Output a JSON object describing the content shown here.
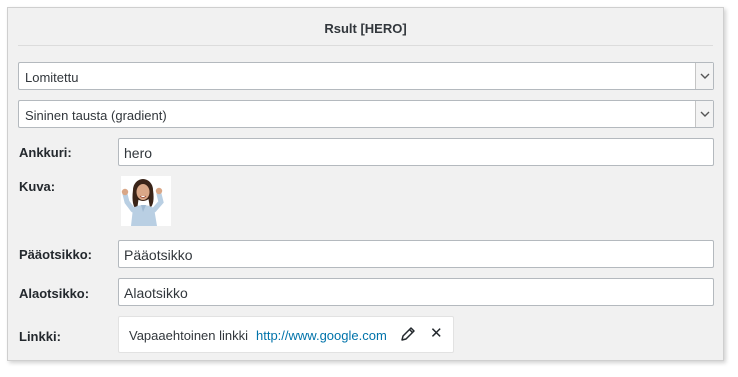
{
  "panel": {
    "title": "Rsult [HERO]"
  },
  "layout_select": {
    "value": "Lomitettu"
  },
  "background_select": {
    "value": "Sininen tausta (gradient)"
  },
  "fields": {
    "anchor": {
      "label": "Ankkuri:",
      "value": "hero"
    },
    "image": {
      "label": "Kuva:"
    },
    "heading": {
      "label": "Pääotsikko:",
      "value": "Pääotsikko"
    },
    "subheading": {
      "label": "Alaotsikko:",
      "value": "Alaotsikko"
    },
    "link": {
      "label": "Linkki:",
      "description": "Vapaaehtoinen linkki",
      "url": "http://www.google.com"
    }
  },
  "icons": {
    "select_arrow": "chevron-down-icon",
    "edit": "pencil-icon",
    "remove": "close-icon"
  },
  "colors": {
    "link": "#0073aa",
    "panel_bg": "#f1f1f1"
  }
}
